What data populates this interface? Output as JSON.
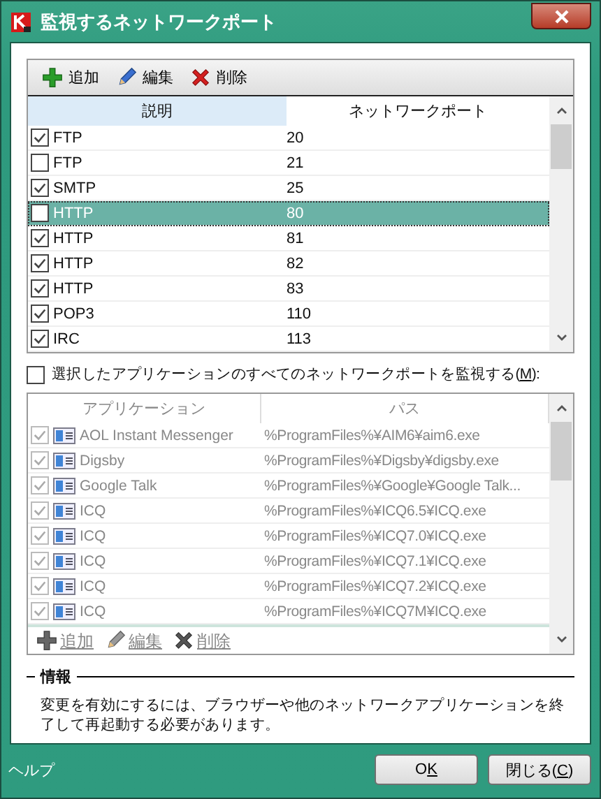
{
  "window": {
    "title": "監視するネットワークポート"
  },
  "ports": {
    "toolbar": [
      {
        "kind": "add",
        "label": "追加"
      },
      {
        "kind": "edit",
        "label": "編集"
      },
      {
        "kind": "delete",
        "label": "削除"
      }
    ],
    "columns": [
      {
        "label": "説明",
        "selected": true
      },
      {
        "label": "ネットワークポート",
        "selected": false
      }
    ],
    "rows": [
      {
        "name": "FTP",
        "port": "20",
        "checked": true,
        "selected": false
      },
      {
        "name": "FTP",
        "port": "21",
        "checked": false,
        "selected": false
      },
      {
        "name": "SMTP",
        "port": "25",
        "checked": true,
        "selected": false
      },
      {
        "name": "HTTP",
        "port": "80",
        "checked": false,
        "selected": true
      },
      {
        "name": "HTTP",
        "port": "81",
        "checked": true,
        "selected": false
      },
      {
        "name": "HTTP",
        "port": "82",
        "checked": true,
        "selected": false
      },
      {
        "name": "HTTP",
        "port": "83",
        "checked": true,
        "selected": false
      },
      {
        "name": "POP3",
        "port": "110",
        "checked": true,
        "selected": false
      },
      {
        "name": "IRC",
        "port": "113",
        "checked": true,
        "selected": false
      }
    ]
  },
  "monitor_all": {
    "before": "選択したアプリケーションのすべてのネットワークポートを監視する(",
    "mnemonic": "M",
    "after": "):",
    "checked": false
  },
  "apps": {
    "disabled": true,
    "columns": [
      "アプリケーション",
      "パス"
    ],
    "rows": [
      {
        "name": "AOL Instant Messenger",
        "path": "%ProgramFiles%¥AIM6¥aim6.exe",
        "checked": true
      },
      {
        "name": "Digsby",
        "path": "%ProgramFiles%¥Digsby¥digsby.exe",
        "checked": true
      },
      {
        "name": "Google Talk",
        "path": "%ProgramFiles%¥Google¥Google Talk...",
        "checked": true
      },
      {
        "name": "ICQ",
        "path": "%ProgramFiles%¥ICQ6.5¥ICQ.exe",
        "checked": true
      },
      {
        "name": "ICQ",
        "path": "%ProgramFiles%¥ICQ7.0¥ICQ.exe",
        "checked": true
      },
      {
        "name": "ICQ",
        "path": "%ProgramFiles%¥ICQ7.1¥ICQ.exe",
        "checked": true
      },
      {
        "name": "ICQ",
        "path": "%ProgramFiles%¥ICQ7.2¥ICQ.exe",
        "checked": true
      },
      {
        "name": "ICQ",
        "path": "%ProgramFiles%¥ICQ7M¥ICQ.exe",
        "checked": true
      }
    ],
    "toolbar": [
      {
        "kind": "add",
        "label": "追加"
      },
      {
        "kind": "edit",
        "label": "編集"
      },
      {
        "kind": "delete",
        "label": "削除"
      }
    ]
  },
  "info": {
    "heading": "情報",
    "text": "変更を有効にするには、ブラウザーや他のネットワークアプリケーションを終了して再起動する必要があります。"
  },
  "footer": {
    "help": "ヘルプ",
    "buttons": [
      {
        "before": "O",
        "mnemonic": "K"
      },
      {
        "before": "閉じる(",
        "mnemonic": "C",
        "after": ")"
      }
    ]
  }
}
